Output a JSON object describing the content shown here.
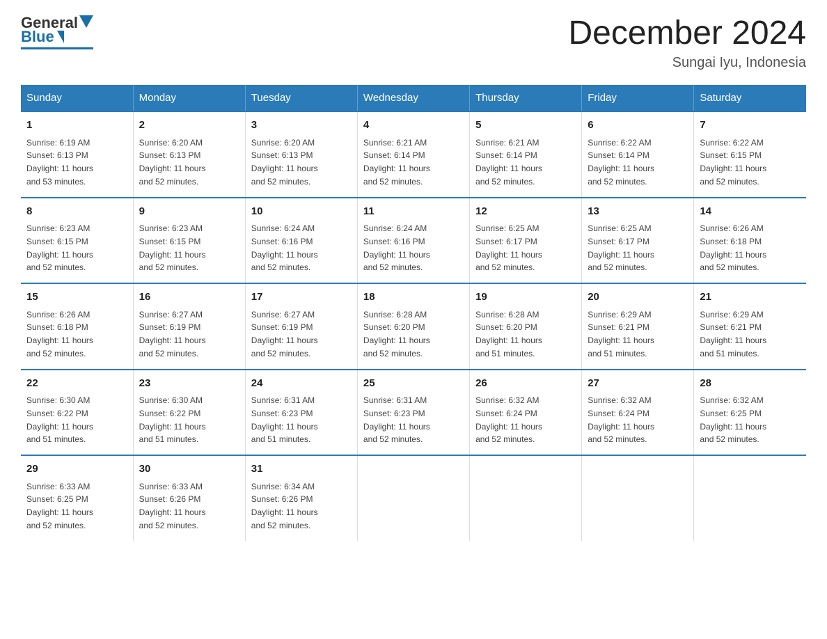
{
  "header": {
    "logo_general": "General",
    "logo_blue": "Blue",
    "month_title": "December 2024",
    "location": "Sungai Iyu, Indonesia"
  },
  "days_of_week": [
    "Sunday",
    "Monday",
    "Tuesday",
    "Wednesday",
    "Thursday",
    "Friday",
    "Saturday"
  ],
  "weeks": [
    [
      {
        "day": "1",
        "sunrise": "6:19 AM",
        "sunset": "6:13 PM",
        "daylight": "11 hours and 53 minutes."
      },
      {
        "day": "2",
        "sunrise": "6:20 AM",
        "sunset": "6:13 PM",
        "daylight": "11 hours and 52 minutes."
      },
      {
        "day": "3",
        "sunrise": "6:20 AM",
        "sunset": "6:13 PM",
        "daylight": "11 hours and 52 minutes."
      },
      {
        "day": "4",
        "sunrise": "6:21 AM",
        "sunset": "6:14 PM",
        "daylight": "11 hours and 52 minutes."
      },
      {
        "day": "5",
        "sunrise": "6:21 AM",
        "sunset": "6:14 PM",
        "daylight": "11 hours and 52 minutes."
      },
      {
        "day": "6",
        "sunrise": "6:22 AM",
        "sunset": "6:14 PM",
        "daylight": "11 hours and 52 minutes."
      },
      {
        "day": "7",
        "sunrise": "6:22 AM",
        "sunset": "6:15 PM",
        "daylight": "11 hours and 52 minutes."
      }
    ],
    [
      {
        "day": "8",
        "sunrise": "6:23 AM",
        "sunset": "6:15 PM",
        "daylight": "11 hours and 52 minutes."
      },
      {
        "day": "9",
        "sunrise": "6:23 AM",
        "sunset": "6:15 PM",
        "daylight": "11 hours and 52 minutes."
      },
      {
        "day": "10",
        "sunrise": "6:24 AM",
        "sunset": "6:16 PM",
        "daylight": "11 hours and 52 minutes."
      },
      {
        "day": "11",
        "sunrise": "6:24 AM",
        "sunset": "6:16 PM",
        "daylight": "11 hours and 52 minutes."
      },
      {
        "day": "12",
        "sunrise": "6:25 AM",
        "sunset": "6:17 PM",
        "daylight": "11 hours and 52 minutes."
      },
      {
        "day": "13",
        "sunrise": "6:25 AM",
        "sunset": "6:17 PM",
        "daylight": "11 hours and 52 minutes."
      },
      {
        "day": "14",
        "sunrise": "6:26 AM",
        "sunset": "6:18 PM",
        "daylight": "11 hours and 52 minutes."
      }
    ],
    [
      {
        "day": "15",
        "sunrise": "6:26 AM",
        "sunset": "6:18 PM",
        "daylight": "11 hours and 52 minutes."
      },
      {
        "day": "16",
        "sunrise": "6:27 AM",
        "sunset": "6:19 PM",
        "daylight": "11 hours and 52 minutes."
      },
      {
        "day": "17",
        "sunrise": "6:27 AM",
        "sunset": "6:19 PM",
        "daylight": "11 hours and 52 minutes."
      },
      {
        "day": "18",
        "sunrise": "6:28 AM",
        "sunset": "6:20 PM",
        "daylight": "11 hours and 52 minutes."
      },
      {
        "day": "19",
        "sunrise": "6:28 AM",
        "sunset": "6:20 PM",
        "daylight": "11 hours and 51 minutes."
      },
      {
        "day": "20",
        "sunrise": "6:29 AM",
        "sunset": "6:21 PM",
        "daylight": "11 hours and 51 minutes."
      },
      {
        "day": "21",
        "sunrise": "6:29 AM",
        "sunset": "6:21 PM",
        "daylight": "11 hours and 51 minutes."
      }
    ],
    [
      {
        "day": "22",
        "sunrise": "6:30 AM",
        "sunset": "6:22 PM",
        "daylight": "11 hours and 51 minutes."
      },
      {
        "day": "23",
        "sunrise": "6:30 AM",
        "sunset": "6:22 PM",
        "daylight": "11 hours and 51 minutes."
      },
      {
        "day": "24",
        "sunrise": "6:31 AM",
        "sunset": "6:23 PM",
        "daylight": "11 hours and 51 minutes."
      },
      {
        "day": "25",
        "sunrise": "6:31 AM",
        "sunset": "6:23 PM",
        "daylight": "11 hours and 52 minutes."
      },
      {
        "day": "26",
        "sunrise": "6:32 AM",
        "sunset": "6:24 PM",
        "daylight": "11 hours and 52 minutes."
      },
      {
        "day": "27",
        "sunrise": "6:32 AM",
        "sunset": "6:24 PM",
        "daylight": "11 hours and 52 minutes."
      },
      {
        "day": "28",
        "sunrise": "6:32 AM",
        "sunset": "6:25 PM",
        "daylight": "11 hours and 52 minutes."
      }
    ],
    [
      {
        "day": "29",
        "sunrise": "6:33 AM",
        "sunset": "6:25 PM",
        "daylight": "11 hours and 52 minutes."
      },
      {
        "day": "30",
        "sunrise": "6:33 AM",
        "sunset": "6:26 PM",
        "daylight": "11 hours and 52 minutes."
      },
      {
        "day": "31",
        "sunrise": "6:34 AM",
        "sunset": "6:26 PM",
        "daylight": "11 hours and 52 minutes."
      },
      null,
      null,
      null,
      null
    ]
  ],
  "labels": {
    "sunrise": "Sunrise:",
    "sunset": "Sunset:",
    "daylight": "Daylight:"
  }
}
